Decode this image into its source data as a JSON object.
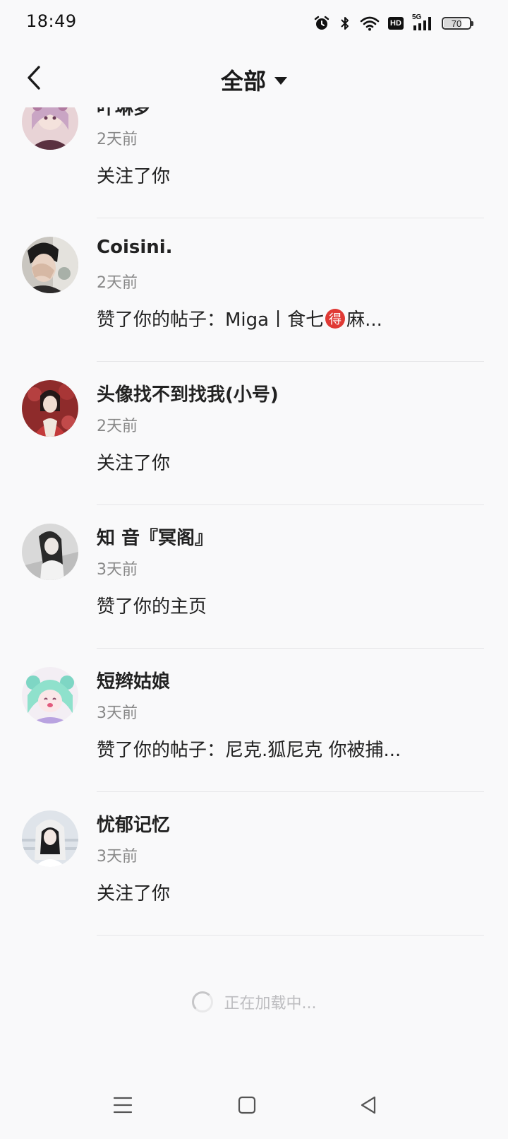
{
  "status_bar": {
    "time": "18:49",
    "battery": "70",
    "battery_level": 0.7,
    "hd_label": "HD",
    "net_label": "5G",
    "icons": [
      "alarm-icon",
      "bluetooth-icon",
      "wifi-icon",
      "hd-icon",
      "signal-5g-icon",
      "battery-icon"
    ]
  },
  "header": {
    "title": "全部",
    "back_icon": "chevron-left-icon",
    "dropdown_icon": "caret-down-icon"
  },
  "notifications": [
    {
      "username": "叶琳梦",
      "time": "2天前",
      "action": "关注了你"
    },
    {
      "username": "Coisini.",
      "time": "2天前",
      "action_prefix": "赞了你的帖子：Miga丨食七",
      "badge": "得",
      "action_suffix": "麻..."
    },
    {
      "username": "头像找不到找我(小号)",
      "time": "2天前",
      "action": "关注了你"
    },
    {
      "username": "知 音『冥阁』",
      "time": "3天前",
      "action": "赞了你的主页"
    },
    {
      "username": "短辫姑娘",
      "time": "3天前",
      "action": "赞了你的帖子：尼克.狐尼克 你被捕..."
    },
    {
      "username": "忧郁记忆",
      "time": "3天前",
      "action": "关注了你"
    }
  ],
  "loading": {
    "text": "正在加载中..."
  },
  "system_nav": {
    "icons": [
      "menu-icon",
      "home-square-icon",
      "back-triangle-icon"
    ]
  },
  "colors": {
    "background": "#f9f9fa",
    "text_primary": "#222222",
    "text_secondary": "#888888",
    "badge_red": "#e03a35",
    "loading_text": "#bdbdc0"
  }
}
